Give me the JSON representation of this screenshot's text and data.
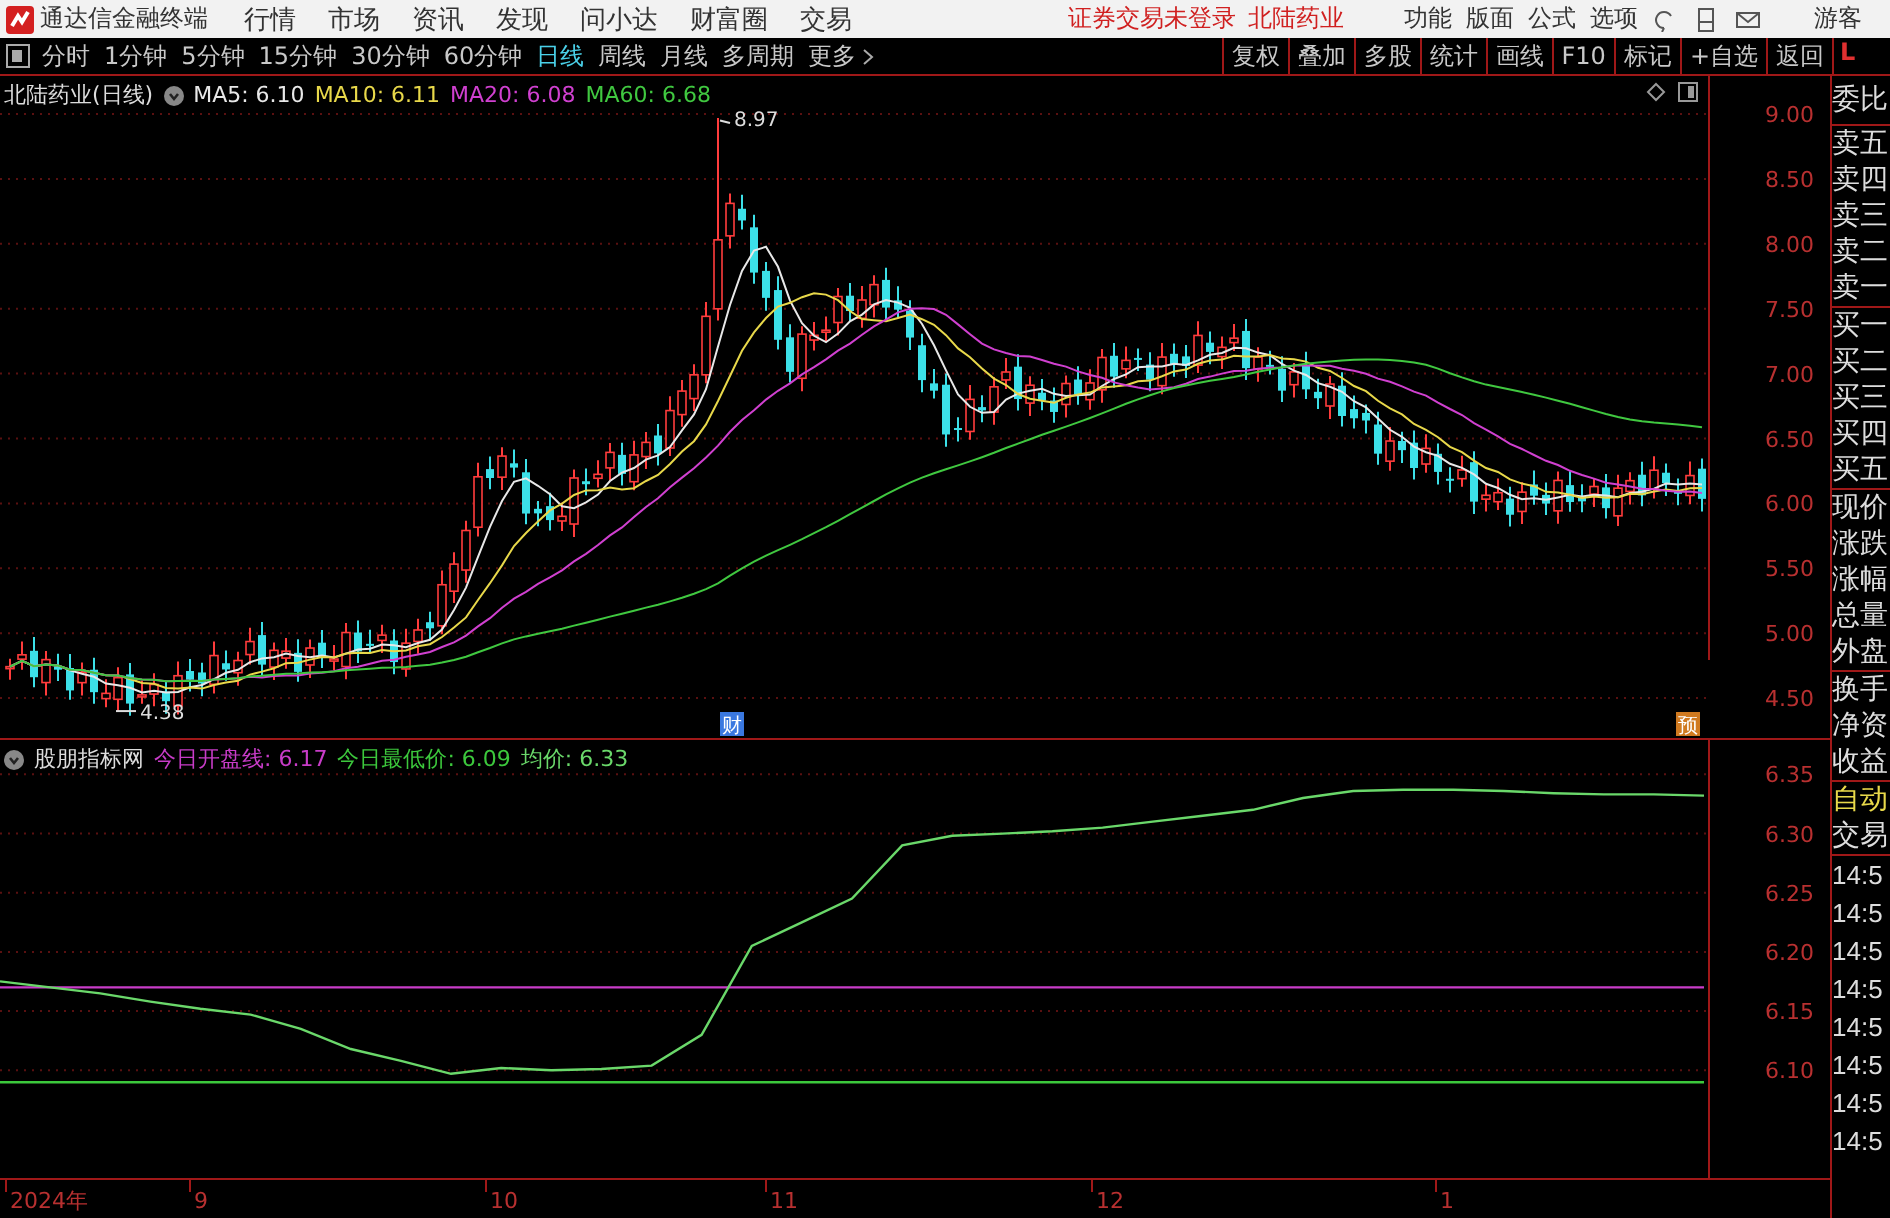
{
  "menubar": {
    "app_title": "通达信金融终端",
    "menus": [
      "行情",
      "市场",
      "资讯",
      "发现",
      "问小达",
      "财富圈",
      "交易"
    ],
    "status": "证券交易未登录",
    "stock": "北陆药业",
    "tools": [
      "功能",
      "版面",
      "公式",
      "选项"
    ],
    "user": "游客"
  },
  "toolbar": {
    "periods": [
      {
        "label": "分时",
        "selected": false
      },
      {
        "label": "1分钟",
        "selected": false
      },
      {
        "label": "5分钟",
        "selected": false
      },
      {
        "label": "15分钟",
        "selected": false
      },
      {
        "label": "30分钟",
        "selected": false
      },
      {
        "label": "60分钟",
        "selected": false
      },
      {
        "label": "日线",
        "selected": true
      },
      {
        "label": "周线",
        "selected": false
      },
      {
        "label": "月线",
        "selected": false
      },
      {
        "label": "多周期",
        "selected": false
      }
    ],
    "more": "更多",
    "actions": [
      "复权",
      "叠加",
      "多股",
      "统计",
      "画线",
      "F10",
      "标记",
      "+自选",
      "返回"
    ],
    "corner": "L"
  },
  "main_chart": {
    "title": "北陆药业(日线)",
    "indicators": [
      {
        "label": "MA5: 6.10",
        "color": "#e8e8e8"
      },
      {
        "label": "MA10: 6.11",
        "color": "#e8d84a"
      },
      {
        "label": "MA20: 6.08",
        "color": "#d040d0"
      },
      {
        "label": "MA60: 6.68",
        "color": "#40c840"
      }
    ],
    "high_label": "8.97",
    "low_label": "4.38",
    "markers": [
      {
        "kind": "finance",
        "label": "财"
      },
      {
        "kind": "forecast",
        "label": "预"
      }
    ],
    "price_axis": [
      "9.00",
      "8.50",
      "8.00",
      "7.50",
      "7.00",
      "6.50",
      "6.00",
      "5.50",
      "5.00",
      "4.50"
    ]
  },
  "sub_chart": {
    "title": "股朋指标网",
    "legend_values": [
      ": 6.17",
      ": 6.09",
      ": 6.33"
    ],
    "chart_data": {
      "type": "line",
      "grid": true,
      "ylim": [
        6.009,
        6.379
      ],
      "yticks": [
        6.35,
        {
          "value": 6.3,
          "label": "6.30"
        },
        6.25,
        {
          "value": 6.2,
          "label": "6.20"
        },
        6.15,
        {
          "value": 6.1,
          "label": "6.10"
        }
      ],
      "series": [
        {
          "name": "今日开盘线",
          "color": "#c83cc8",
          "values": [
            6.17,
            6.17,
            6.17,
            6.17,
            6.17,
            6.17,
            6.17,
            6.17,
            6.17,
            6.17,
            6.17,
            6.17,
            6.17,
            6.17,
            6.17,
            6.17,
            6.17,
            6.17,
            6.17,
            6.17,
            6.17,
            6.17,
            6.17,
            6.17,
            6.17,
            6.17,
            6.17,
            6.17,
            6.17,
            6.17,
            6.17,
            6.17,
            6.17,
            6.17,
            6.17
          ]
        },
        {
          "name": "今日最低价",
          "color": "#3cc83c",
          "values": [
            6.09,
            6.09,
            6.09,
            6.09,
            6.09,
            6.09,
            6.09,
            6.09,
            6.09,
            6.09,
            6.09,
            6.09,
            6.09,
            6.09,
            6.09,
            6.09,
            6.09,
            6.09,
            6.09,
            6.09,
            6.09,
            6.09,
            6.09,
            6.09,
            6.09,
            6.09,
            6.09,
            6.09,
            6.09,
            6.09,
            6.09,
            6.09,
            6.09,
            6.09,
            6.09
          ]
        },
        {
          "name": "均价",
          "color": "#6ad86a",
          "values": [
            6.175,
            6.17,
            6.165,
            6.158,
            6.152,
            6.147,
            6.135,
            6.118,
            6.108,
            6.097,
            6.102,
            6.1,
            6.101,
            6.104,
            6.13,
            6.205,
            6.225,
            6.245,
            6.29,
            6.298,
            6.3,
            6.302,
            6.305,
            6.31,
            6.315,
            6.32,
            6.33,
            6.336,
            6.337,
            6.337,
            6.336,
            6.334,
            6.333,
            6.333,
            6.332
          ]
        }
      ]
    }
  },
  "time_axis": [
    "2024年",
    "9",
    "10",
    "11",
    "12",
    "1"
  ],
  "quote_panel": {
    "groups": [
      [
        "委比"
      ],
      [
        "卖五",
        "卖四",
        "卖三",
        "卖二",
        "卖一"
      ],
      [
        "买一",
        "买二",
        "买三",
        "买四",
        "买五"
      ],
      [
        "现价",
        "涨跌",
        "涨幅",
        "总量",
        "外盘"
      ],
      [
        "换手",
        "净资",
        "收益"
      ]
    ],
    "auto": "自动",
    "trade": "交易",
    "times": [
      "14:5",
      "14:5",
      "14:5",
      "14:5",
      "14:5",
      "14:5",
      "14:5",
      "14:5"
    ]
  }
}
